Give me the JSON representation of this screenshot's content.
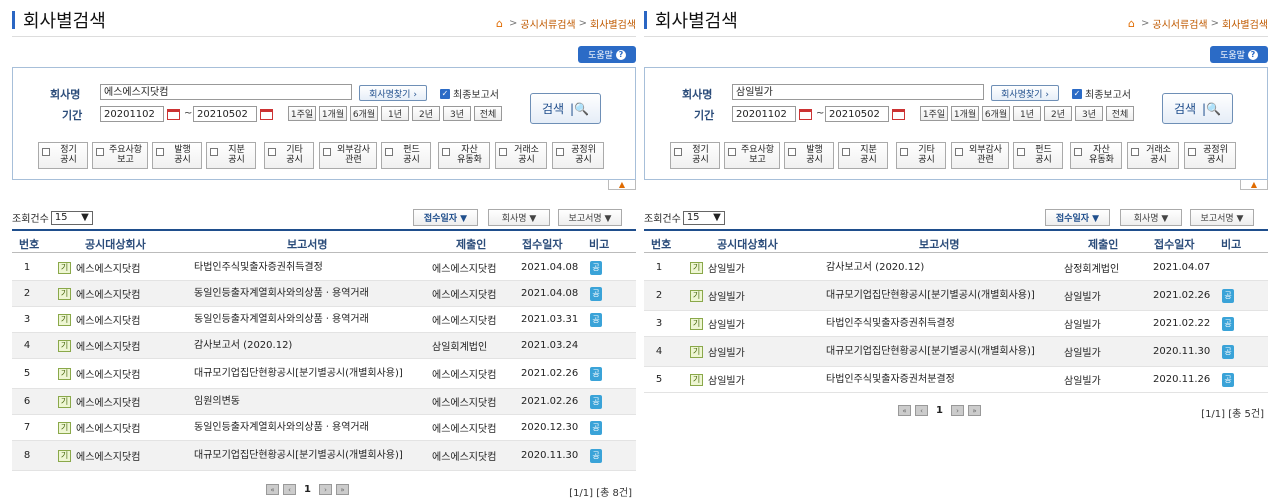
{
  "panels": [
    {
      "title": "회사별검색",
      "breadcrumb": [
        "공시서류검색",
        "회사별검색"
      ],
      "help_label": "도움말",
      "company_label": "회사명",
      "company_value": "에스에스지닷컴",
      "find_label": "회사명찾기 ›",
      "final_report_label": "최종보고서",
      "period_label": "기간",
      "date_from": "20201102",
      "date_to": "20210502",
      "period_buttons": [
        "1주일",
        "1개월",
        "6개월",
        "1년",
        "2년",
        "3년",
        "전체"
      ],
      "search_label": "검색",
      "categories": [
        "정기\n공시",
        "주요사항\n보고",
        "발행\n공시",
        "지분\n공시",
        "기타\n공시",
        "외부감사\n관련",
        "펀드\n공시",
        "자산\n유동화",
        "거래소\n공시",
        "공정위\n공시"
      ],
      "count_label": "조회건수",
      "count_value": "15",
      "sort_buttons": [
        "접수일자 ▼",
        "회사명 ▼",
        "보고서명 ▼"
      ],
      "headers": [
        "번호",
        "공시대상회사",
        "보고서명",
        "제출인",
        "접수일자",
        "비고"
      ],
      "rows": [
        {
          "no": "1",
          "mark": "기",
          "company": "에스에스지닷컴",
          "report": "타법인주식및출자증권취득결정",
          "submitter": "에스에스지닷컴",
          "date": "2021.04.08",
          "note": "공"
        },
        {
          "no": "2",
          "mark": "기",
          "company": "에스에스지닷컴",
          "report": "동일인등출자계열회사와의상품ㆍ용역거래",
          "submitter": "에스에스지닷컴",
          "date": "2021.04.08",
          "note": "공"
        },
        {
          "no": "3",
          "mark": "기",
          "company": "에스에스지닷컴",
          "report": "동일인등출자계열회사와의상품ㆍ용역거래",
          "submitter": "에스에스지닷컴",
          "date": "2021.03.31",
          "note": "공"
        },
        {
          "no": "4",
          "mark": "기",
          "company": "에스에스지닷컴",
          "report": "감사보고서 (2020.12)",
          "submitter": "삼일회계법인",
          "date": "2021.03.24",
          "note": ""
        },
        {
          "no": "5",
          "mark": "기",
          "company": "에스에스지닷컴",
          "report": "대규모기업집단현황공시[분기별공시(개별회사용)]",
          "submitter": "에스에스지닷컴",
          "date": "2021.02.26",
          "note": "공"
        },
        {
          "no": "6",
          "mark": "기",
          "company": "에스에스지닷컴",
          "report": "임원의변동",
          "submitter": "에스에스지닷컴",
          "date": "2021.02.26",
          "note": "공"
        },
        {
          "no": "7",
          "mark": "기",
          "company": "에스에스지닷컴",
          "report": "동일인등출자계열회사와의상품ㆍ용역거래",
          "submitter": "에스에스지닷컴",
          "date": "2020.12.30",
          "note": "공"
        },
        {
          "no": "8",
          "mark": "기",
          "company": "에스에스지닷컴",
          "report": "대규모기업집단현황공시[분기별공시(개별회사용)]",
          "submitter": "에스에스지닷컴",
          "date": "2020.11.30",
          "note": "공"
        }
      ],
      "page": "1",
      "total": "[1/1] [총 8건]"
    },
    {
      "title": "회사별검색",
      "breadcrumb": [
        "공시서류검색",
        "회사별검색"
      ],
      "help_label": "도움말",
      "company_label": "회사명",
      "company_value": "삼일빌가",
      "find_label": "회사명찾기 ›",
      "final_report_label": "최종보고서",
      "period_label": "기간",
      "date_from": "20201102",
      "date_to": "20210502",
      "period_buttons": [
        "1주일",
        "1개월",
        "6개월",
        "1년",
        "2년",
        "3년",
        "전체"
      ],
      "search_label": "검색",
      "categories": [
        "정기\n공시",
        "주요사항\n보고",
        "발행\n공시",
        "지분\n공시",
        "기타\n공시",
        "외부감사\n관련",
        "펀드\n공시",
        "자산\n유동화",
        "거래소\n공시",
        "공정위\n공시"
      ],
      "count_label": "조회건수",
      "count_value": "15",
      "sort_buttons": [
        "접수일자 ▼",
        "회사명 ▼",
        "보고서명 ▼"
      ],
      "headers": [
        "번호",
        "공시대상회사",
        "보고서명",
        "제출인",
        "접수일자",
        "비고"
      ],
      "rows": [
        {
          "no": "1",
          "mark": "기",
          "company": "삼일빌가",
          "report": "감사보고서 (2020.12)",
          "submitter": "삼정회계법인",
          "date": "2021.04.07",
          "note": ""
        },
        {
          "no": "2",
          "mark": "기",
          "company": "삼일빌가",
          "report": "대규모기업집단현황공시[분기별공시(개별회사용)]",
          "submitter": "삼일빌가",
          "date": "2021.02.26",
          "note": "공"
        },
        {
          "no": "3",
          "mark": "기",
          "company": "삼일빌가",
          "report": "타법인주식및출자증권취득결정",
          "submitter": "삼일빌가",
          "date": "2021.02.22",
          "note": "공"
        },
        {
          "no": "4",
          "mark": "기",
          "company": "삼일빌가",
          "report": "대규모기업집단현황공시[분기별공시(개별회사용)]",
          "submitter": "삼일빌가",
          "date": "2020.11.30",
          "note": "공"
        },
        {
          "no": "5",
          "mark": "기",
          "company": "삼일빌가",
          "report": "타법인주식및출자증권처분결정",
          "submitter": "삼일빌가",
          "date": "2020.11.26",
          "note": "공"
        }
      ],
      "page": "1",
      "total": "[1/1] [총 5건]"
    }
  ]
}
